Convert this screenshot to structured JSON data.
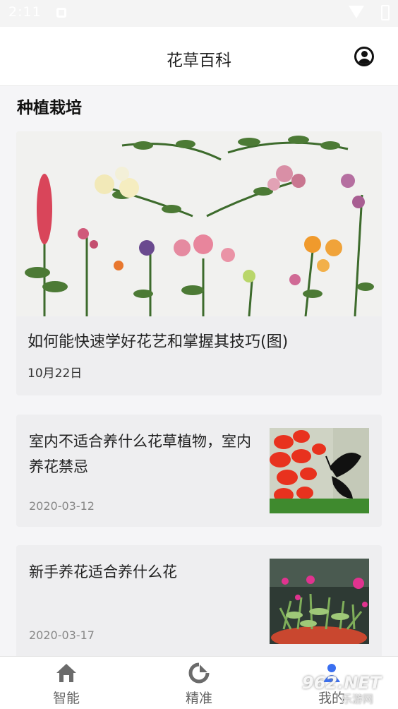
{
  "status_bar": {
    "time": "2:11"
  },
  "header": {
    "title": "花草百科"
  },
  "section": {
    "title": "种植栽培"
  },
  "featured": {
    "title": "如何能快速学好花艺和掌握其技巧(图)",
    "date": "10月22日"
  },
  "articles": [
    {
      "title": "室内不适合养什么花草植物，室内养花禁忌",
      "date": "2020-03-12"
    },
    {
      "title": "新手养花适合养什么花",
      "date": "2020-03-17"
    }
  ],
  "tabs": [
    {
      "label": "智能",
      "icon": "home-icon"
    },
    {
      "label": "精准",
      "icon": "refresh-icon"
    },
    {
      "label": "我的",
      "icon": "person-icon"
    }
  ],
  "watermark": {
    "brand": "962.NET",
    "sub": "乐游网"
  },
  "colors": {
    "accent": "#3a6ff0",
    "card_bg": "#eeeef0"
  }
}
